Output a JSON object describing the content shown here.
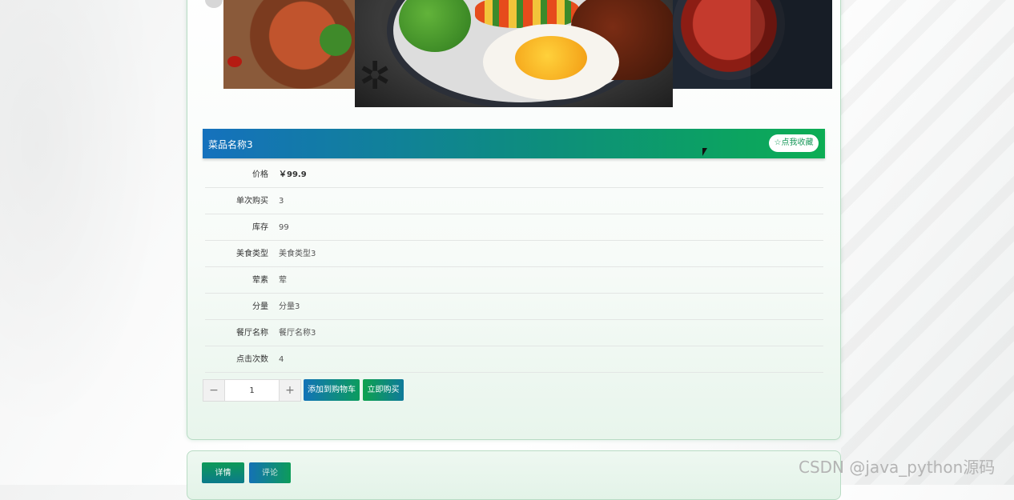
{
  "product": {
    "name": "菜品名称3",
    "favorite_label": "☆点我收藏"
  },
  "details": [
    {
      "label": "价格",
      "value": "￥99.9"
    },
    {
      "label": "单次购买",
      "value": "3"
    },
    {
      "label": "库存",
      "value": "99"
    },
    {
      "label": "美食类型",
      "value": "美食类型3"
    },
    {
      "label": "荤素",
      "value": "荤"
    },
    {
      "label": "分量",
      "value": "分量3"
    },
    {
      "label": "餐厅名称",
      "value": "餐厅名称3"
    },
    {
      "label": "点击次数",
      "value": "4"
    }
  ],
  "purchase": {
    "quantity": "1",
    "minus": "−",
    "plus": "+",
    "add_to_cart": "添加到购物车",
    "buy_now": "立即购买"
  },
  "tabs": {
    "detail": "详情",
    "comment": "评论"
  },
  "watermark": "CSDN @java_python源码",
  "colors": {
    "brand_blue": "#1571bd",
    "brand_green": "#0cad54"
  }
}
